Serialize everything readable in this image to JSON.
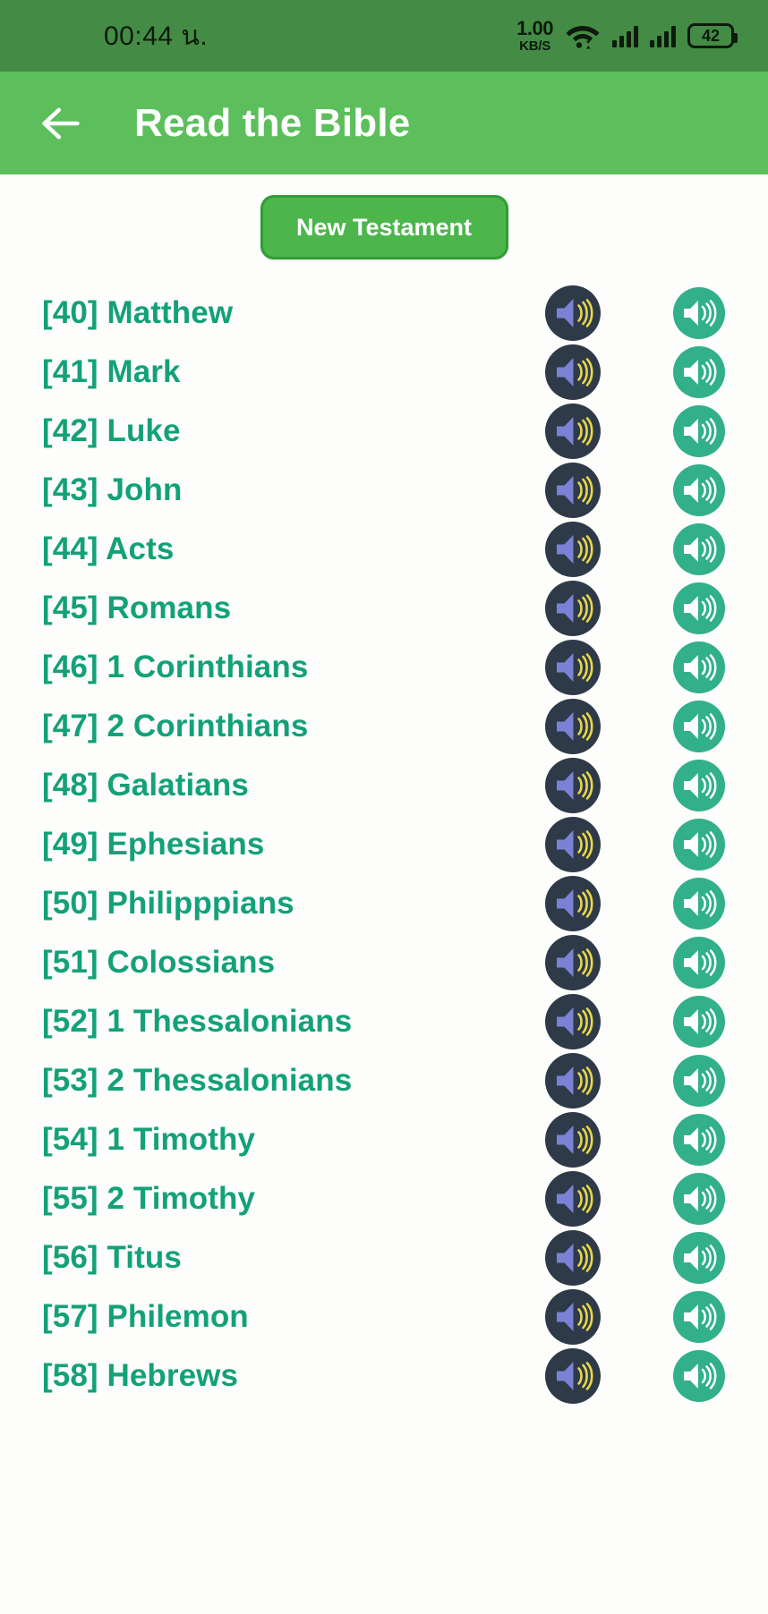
{
  "status_bar": {
    "time": "00:44 น.",
    "net_speed_value": "1.00",
    "net_speed_unit": "KB/S",
    "wifi_icon": "wifi-icon",
    "signal_icon_1": "signal-bars-icon",
    "signal_icon_2": "signal-bars-icon",
    "battery_level": "42",
    "bg_color": "#448C45"
  },
  "app_bar": {
    "back_icon": "back-arrow-icon",
    "title": "Read the Bible",
    "bg_color": "#5CBF5C",
    "title_color": "#FFFFFF"
  },
  "testament_toggle": {
    "label": "New Testament",
    "bg_color": "#4CB64C",
    "border_color": "#2E9E35",
    "text_color": "#FFFFFF"
  },
  "icons": {
    "play_audio_dark": "speaker-audio-icon",
    "play_audio_teal": "speaker-volume-icon",
    "dark_circle_color": "#2F3A49",
    "dark_cone_color": "#7B82D6",
    "dark_wave_color": "#E8D84A",
    "teal_circle_color": "#31B08A",
    "teal_glyph_color": "#FFFFFF"
  },
  "list": {
    "text_color": "#13A178",
    "background": "#FDFDFB",
    "books": [
      {
        "number": "[40]",
        "name": "Matthew",
        "label": "[40] Matthew"
      },
      {
        "number": "[41]",
        "name": "Mark",
        "label": "[41] Mark"
      },
      {
        "number": "[42]",
        "name": "Luke",
        "label": "[42] Luke"
      },
      {
        "number": "[43]",
        "name": "John",
        "label": "[43] John"
      },
      {
        "number": "[44]",
        "name": "Acts",
        "label": "[44] Acts"
      },
      {
        "number": "[45]",
        "name": "Romans",
        "label": "[45] Romans"
      },
      {
        "number": "[46]",
        "name": "1 Corinthians",
        "label": "[46] 1 Corinthians"
      },
      {
        "number": "[47]",
        "name": "2 Corinthians",
        "label": "[47] 2 Corinthians"
      },
      {
        "number": "[48]",
        "name": "Galatians",
        "label": "[48] Galatians"
      },
      {
        "number": "[49]",
        "name": "Ephesians",
        "label": "[49] Ephesians"
      },
      {
        "number": "[50]",
        "name": "Philipppians",
        "label": "[50] Philipppians"
      },
      {
        "number": "[51]",
        "name": "Colossians",
        "label": "[51] Colossians"
      },
      {
        "number": "[52]",
        "name": "1 Thessalonians",
        "label": "[52] 1 Thessalonians"
      },
      {
        "number": "[53]",
        "name": "2 Thessalonians",
        "label": "[53] 2 Thessalonians"
      },
      {
        "number": "[54]",
        "name": "1 Timothy",
        "label": "[54] 1 Timothy"
      },
      {
        "number": "[55]",
        "name": "2 Timothy",
        "label": "[55] 2 Timothy"
      },
      {
        "number": "[56]",
        "name": "Titus",
        "label": "[56] Titus"
      },
      {
        "number": "[57]",
        "name": "Philemon",
        "label": "[57] Philemon"
      },
      {
        "number": "[58]",
        "name": "Hebrews",
        "label": "[58] Hebrews"
      }
    ]
  }
}
